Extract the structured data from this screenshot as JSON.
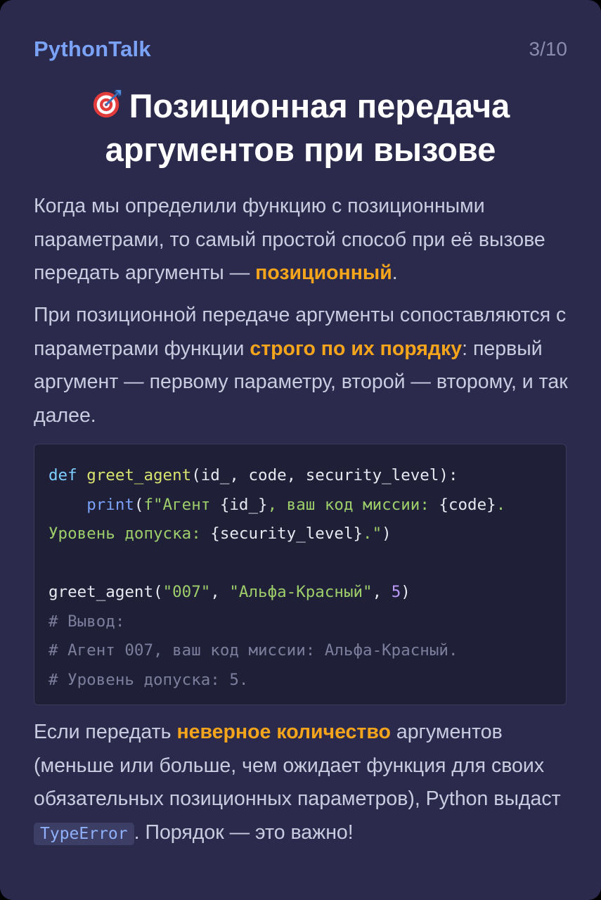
{
  "header": {
    "brand": "PythonTalk",
    "page_counter": "3/10"
  },
  "title": {
    "icon": "dart-target-icon",
    "line1": "Позиционная передача",
    "line2": "аргументов при вызове"
  },
  "paragraph1": {
    "text_before": "Когда мы определили функцию с позиционными параметрами, то самый простой способ при её вызове передать аргументы — ",
    "highlight": "позиционный",
    "text_after": "."
  },
  "paragraph2": {
    "text_before": "При позиционной передаче аргументы сопоставляются с параметрами функции ",
    "highlight": "строго по их порядку",
    "text_after": ": первый аргумент — первому параметру, второй — второму, и так далее."
  },
  "code": {
    "line1": {
      "kw": "def",
      "fn": "greet_agent",
      "rest": "(id_, code, security_level):"
    },
    "line2": {
      "indent": "    ",
      "builtin": "print",
      "open_paren": "(",
      "str1": "f\"Агент ",
      "var1": "{id_}",
      "str2": ", ваш код миссии: ",
      "var2": "{code}",
      "str3": "."
    },
    "line3": {
      "str1": "Уровень допуска: ",
      "var1": "{security_level}",
      "str2": ".\"",
      "close": ")"
    },
    "line5": {
      "fn": "greet_agent(",
      "str1": "\"007\"",
      "sep1": ", ",
      "str2": "\"Альфа-Красный\"",
      "sep2": ", ",
      "num": "5",
      "close": ")"
    },
    "comment1": "# Вывод:",
    "comment2": "# Агент 007, ваш код миссии: Альфа-Красный.",
    "comment3": "# Уровень допуска: 5."
  },
  "paragraph3": {
    "text_before": "Если передать ",
    "highlight": "неверное количество",
    "text_middle": " аргументов (меньше или больше, чем ожидает функция для своих обязательных позиционных параметров), Python выдаст ",
    "inline_code": "TypeError",
    "text_after": ". Порядок — это важно!"
  },
  "colors": {
    "background": "#2b2a4c",
    "brand": "#7aa2f7",
    "highlight": "#f4a51c",
    "code_background": "#1f1f38"
  }
}
